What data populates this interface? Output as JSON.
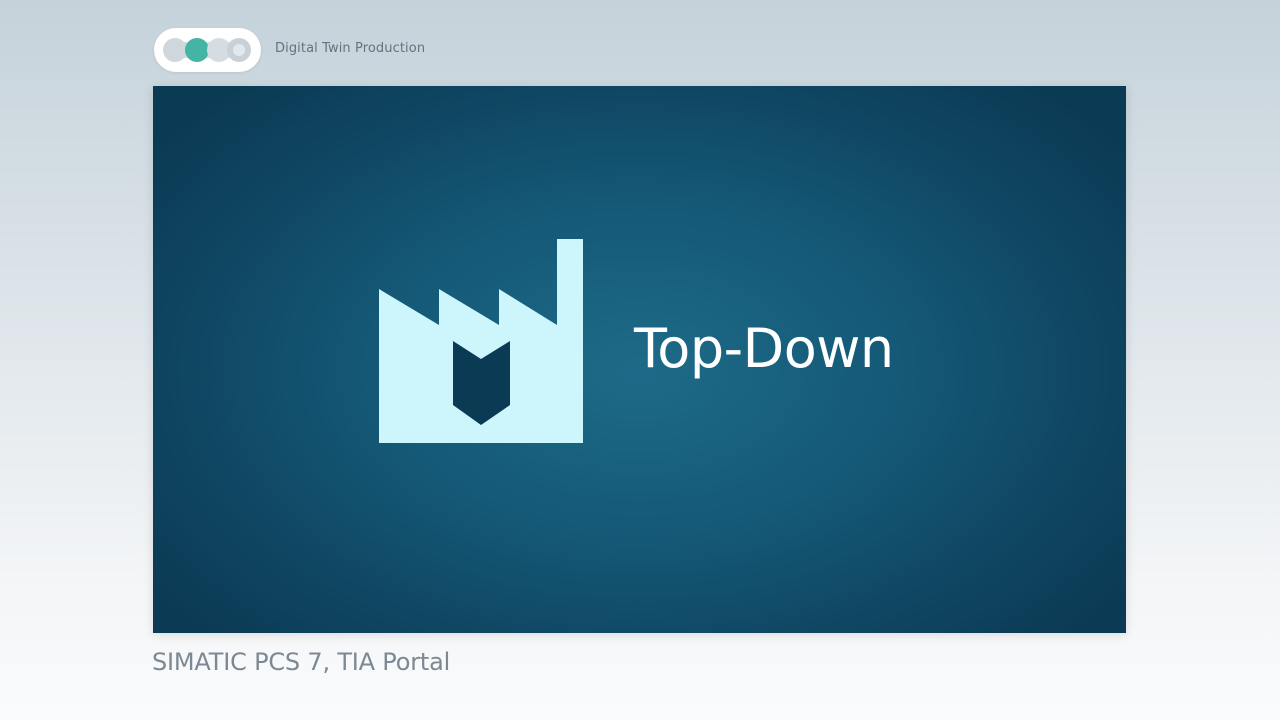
{
  "header": {
    "title": "Digital Twin Production",
    "progress_icon": "step-progress-indicator",
    "active_step_color": "#44b5a5"
  },
  "main": {
    "title": "Top-Down",
    "icon": "factory-icon",
    "background_color": "#145876",
    "icon_color": "#ccf5fc"
  },
  "footer": {
    "caption": "SIMATIC PCS 7, TIA Portal"
  }
}
